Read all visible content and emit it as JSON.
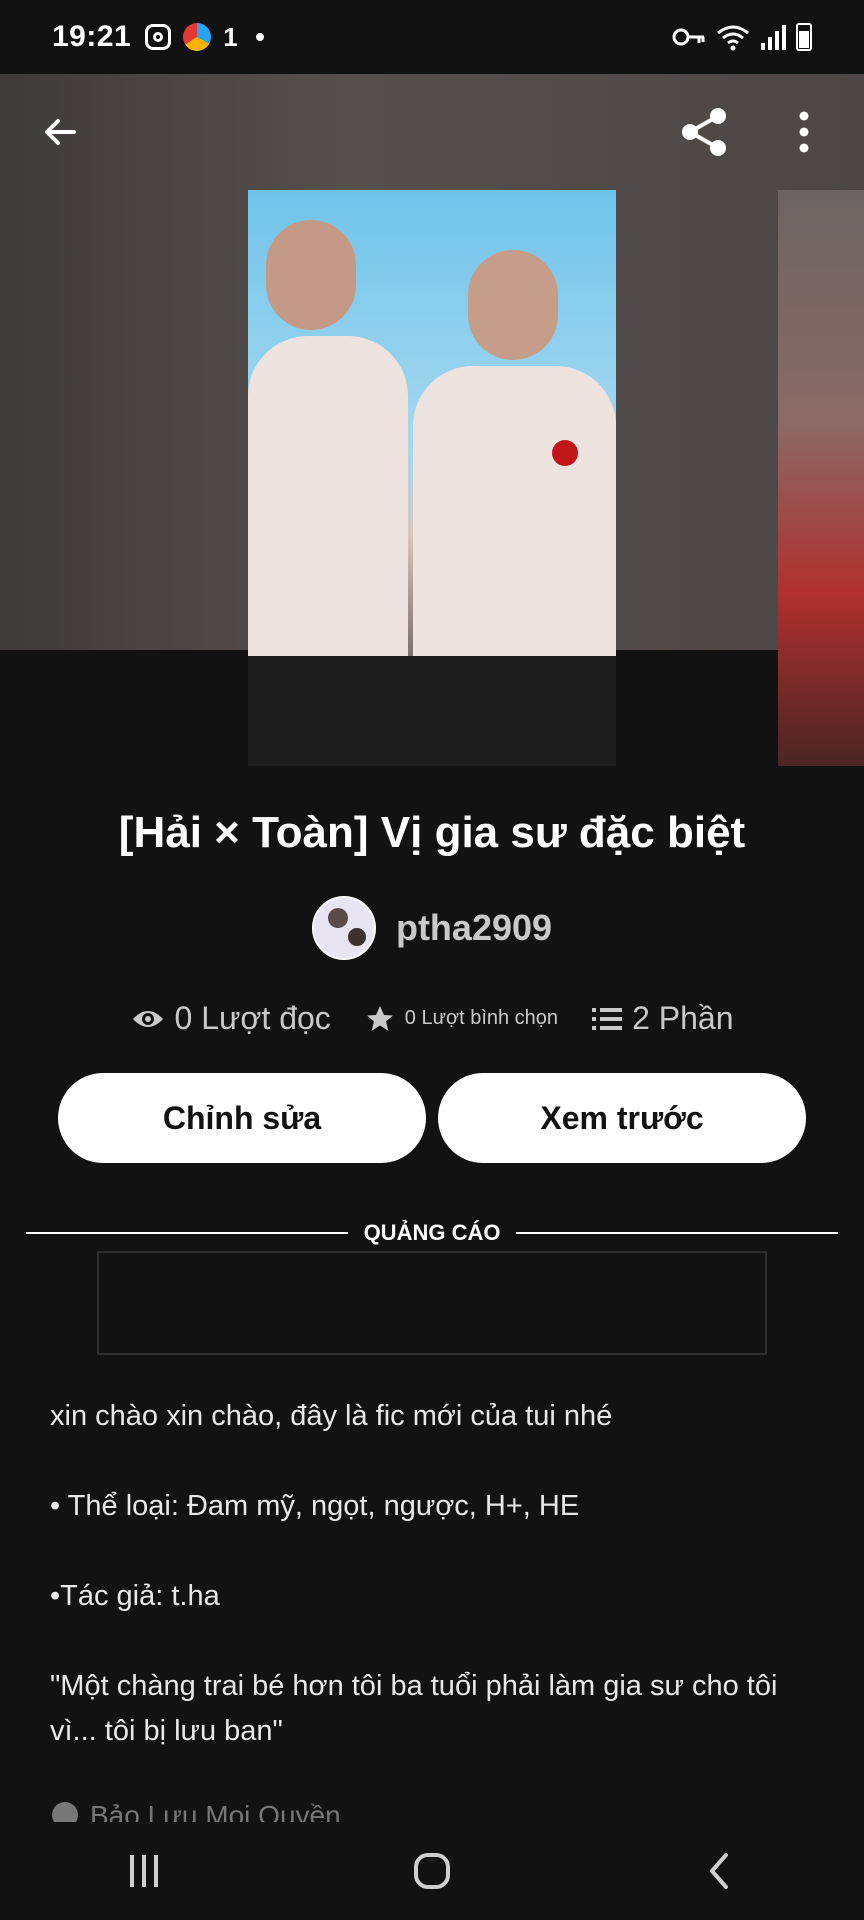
{
  "status_bar": {
    "time": "19:21",
    "notification_text": "1",
    "icons": [
      "instagram-icon",
      "app-icon",
      "dot-icon",
      "key-icon",
      "wifi-icon",
      "signal-icon",
      "battery-icon"
    ]
  },
  "top_bar": {
    "icons": [
      "back-arrow-icon",
      "share-icon",
      "more-vertical-icon"
    ]
  },
  "story": {
    "title": "[Hải × Toàn] Vị gia sư đặc biệt",
    "author": "ptha2909",
    "stats": {
      "reads": "0 Lượt đọc",
      "votes": "0 Lượt bình chọn",
      "parts": "2 Phần"
    }
  },
  "actions": {
    "edit_label": "Chỉnh sửa",
    "preview_label": "Xem trước"
  },
  "ad": {
    "label": "QUẢNG CÁO"
  },
  "description": {
    "line1": "xin chào xin chào, đây là fic mới của tui nhé",
    "line2": "• Thể loại: Đam mỹ, ngọt, ngược, H+, HE",
    "line3": "•Tác giả: t.ha",
    "line4": "\"Một chàng trai bé hơn tôi ba tuổi phải làm gia sư cho tôi vì... tôi bị lưu ban\""
  },
  "copyright": "Bảo Lưu Mọi Quyền",
  "colors": {
    "background": "#121212",
    "button_bg": "#ffffff",
    "muted_text": "#c9c9c9"
  }
}
